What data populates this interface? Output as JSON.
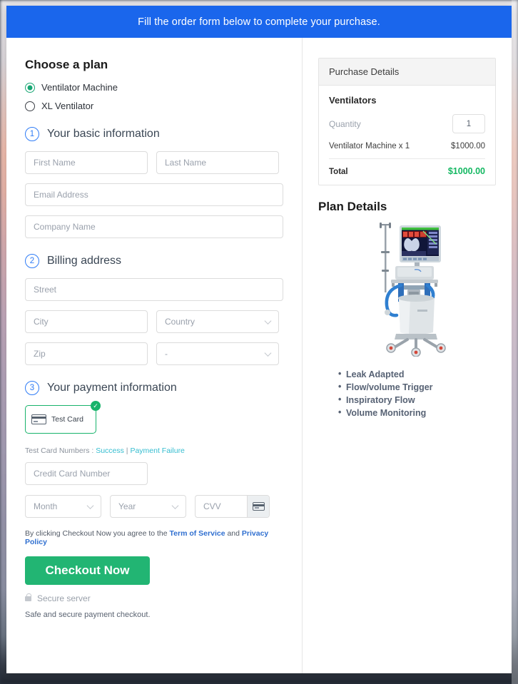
{
  "banner": {
    "message": "Fill the order form below to complete your purchase."
  },
  "plan": {
    "heading": "Choose a plan",
    "options": [
      {
        "label": "Ventilator Machine",
        "selected": true
      },
      {
        "label": "XL Ventilator",
        "selected": false
      }
    ]
  },
  "basic": {
    "step": "1",
    "title": "Your basic information",
    "first_name_placeholder": "First Name",
    "last_name_placeholder": "Last Name",
    "email_placeholder": "Email Address",
    "company_placeholder": "Company Name",
    "first_name_value": "",
    "last_name_value": "",
    "email_value": "",
    "company_value": ""
  },
  "billing": {
    "step": "2",
    "title": "Billing address",
    "street_placeholder": "Street",
    "city_placeholder": "City",
    "country_placeholder": "Country",
    "zip_placeholder": "Zip",
    "state_placeholder": "-",
    "street_value": "",
    "city_value": "",
    "zip_value": ""
  },
  "payment": {
    "step": "3",
    "title": "Your payment information",
    "card_tile_label": "Test  Card",
    "card_tile_selected": true,
    "test_numbers_prefix": "Test Card Numbers : ",
    "test_success_link": "Success",
    "test_separator": " | ",
    "test_failure_link": "Payment Failure",
    "card_number_placeholder": "Credit Card Number",
    "card_number_value": "",
    "month_placeholder": "Month",
    "year_placeholder": "Year",
    "cvv_placeholder": "CVV",
    "cvv_value": ""
  },
  "footer": {
    "terms_prefix": "By clicking Checkout Now you agree to the ",
    "terms_link": "Term of Service",
    "terms_middle": " and ",
    "privacy_link": "Privacy Policy",
    "checkout_label": "Checkout Now",
    "secure_server": "Secure server",
    "safe_note": "Safe and secure payment checkout."
  },
  "purchase": {
    "panel_title": "Purchase Details",
    "group_title": "Ventilators",
    "quantity_label": "Quantity",
    "quantity_value": "1",
    "line_item_label": "Ventilator Machine x 1",
    "line_item_price": "$1000.00",
    "total_label": "Total",
    "total_price": "$1000.00"
  },
  "plan_details": {
    "title": "Plan Details",
    "image_alt": "ventilator-machine-photo",
    "features": [
      "Leak Adapted",
      "Flow/volume Trigger",
      "Inspiratory Flow",
      "Volume Monitoring"
    ]
  },
  "colors": {
    "banner_blue": "#1a66ec",
    "checkout_green": "#22b573",
    "total_green": "#14b862",
    "radio_green": "#17a673",
    "step_blue": "#2f7cf6",
    "link_teal": "#35bdd0",
    "link_blue": "#2f6fd0"
  }
}
